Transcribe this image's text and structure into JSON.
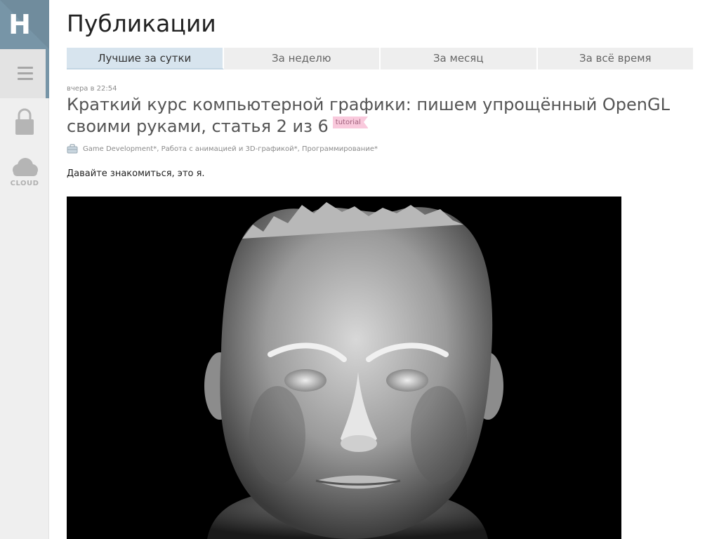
{
  "sidebar": {
    "logo_letter": "H",
    "cloud_label": "CLOUD"
  },
  "header": {
    "title": "Публикации"
  },
  "tabs": [
    {
      "label": "Лучшие за сутки",
      "active": true
    },
    {
      "label": "За неделю",
      "active": false
    },
    {
      "label": "За месяц",
      "active": false
    },
    {
      "label": "За всё время",
      "active": false
    }
  ],
  "post": {
    "date": "вчера в 22:54",
    "title": "Краткий курс компьютерной графики: пишем упрощённый OpenGL своими руками, статья 2 из 6",
    "tag": "tutorial",
    "hubs": "Game Development*, Работа с анимацией и 3D-графикой*, Программирование*",
    "intro": "Давайте знакомиться, это я."
  },
  "colors": {
    "logo_bg": "#7795a7",
    "active_tab_bg": "#d7e4ee",
    "tab_bg": "#eeeeee",
    "tag_bg": "#f9c9dc"
  },
  "icons": {
    "menu": "hamburger-icon",
    "lock": "lock-icon",
    "cloud": "cloud-icon",
    "hubs": "briefcase-icon"
  }
}
